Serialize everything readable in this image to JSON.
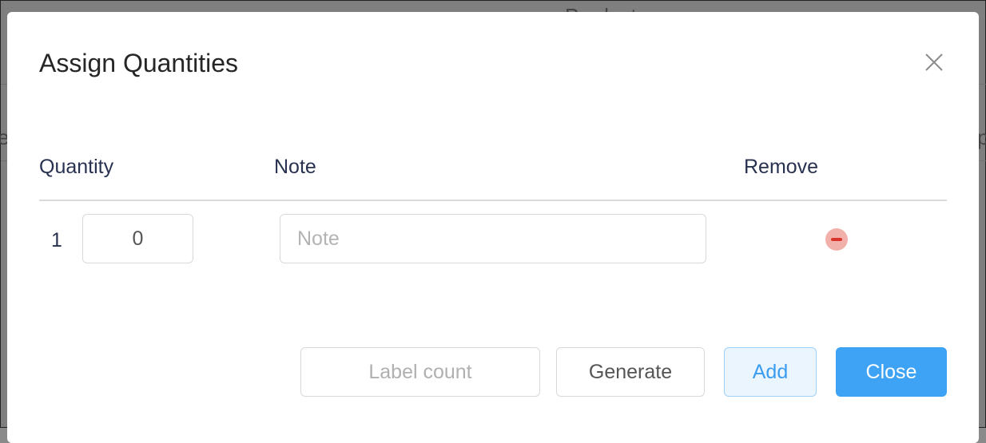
{
  "background": {
    "top_fragment": "Product",
    "left_fragment": "e",
    "right_fragment": "p"
  },
  "dialog": {
    "title": "Assign Quantities",
    "close_icon": "close-icon"
  },
  "table": {
    "headers": {
      "quantity": "Quantity",
      "note": "Note",
      "remove": "Remove"
    },
    "rows": [
      {
        "index": "1",
        "quantity_value": "0",
        "note_value": "",
        "note_placeholder": "Note",
        "remove_icon": "minus-circle-icon"
      }
    ]
  },
  "footer": {
    "label_count_placeholder": "Label count",
    "generate_label": "Generate",
    "add_label": "Add",
    "close_label": "Close"
  },
  "colors": {
    "primary": "#3fa3f5",
    "remove": "#d9342b",
    "heading": "#283250"
  }
}
